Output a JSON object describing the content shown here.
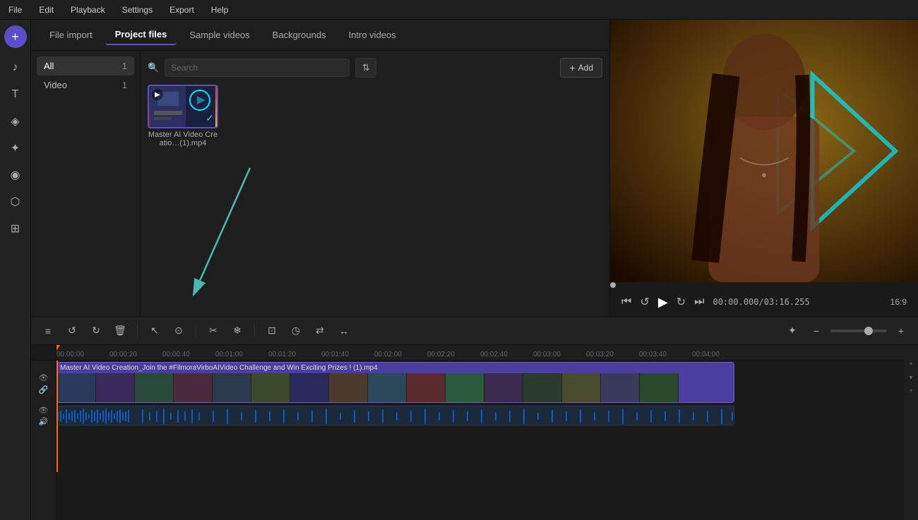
{
  "menubar": {
    "items": [
      "File",
      "Edit",
      "Playback",
      "Settings",
      "Export",
      "Help"
    ]
  },
  "sidebar": {
    "add_icon": "+",
    "items": [
      {
        "name": "music-icon",
        "icon": "♪",
        "active": false
      },
      {
        "name": "text-icon",
        "icon": "T",
        "active": false
      },
      {
        "name": "effects-icon",
        "icon": "◈",
        "active": false
      },
      {
        "name": "sticker-icon",
        "icon": "✦",
        "active": false
      },
      {
        "name": "filters-icon",
        "icon": "◉",
        "active": false
      },
      {
        "name": "mask-icon",
        "icon": "⬡",
        "active": false
      },
      {
        "name": "grid-icon",
        "icon": "⊞",
        "active": false
      }
    ]
  },
  "tabs": {
    "items": [
      {
        "label": "File import",
        "active": false
      },
      {
        "label": "Project files",
        "active": true
      },
      {
        "label": "Sample videos",
        "active": false
      },
      {
        "label": "Backgrounds",
        "active": false
      },
      {
        "label": "Intro videos",
        "active": false
      }
    ]
  },
  "categories": {
    "items": [
      {
        "label": "All",
        "count": 1,
        "active": true
      },
      {
        "label": "Video",
        "count": 1,
        "active": false
      }
    ]
  },
  "search": {
    "placeholder": "Search",
    "value": ""
  },
  "add_button": {
    "label": "Add"
  },
  "files": [
    {
      "name": "Master AI Video Creatio…(1).mp4",
      "duration": "",
      "selected": true
    }
  ],
  "preview": {
    "time_current": "00:00.000",
    "time_total": "03:16.255",
    "aspect_ratio": "16:9"
  },
  "timeline": {
    "clip_label": "Master AI Video Creation_Join the #FilmoraVirboAIVideo Challenge and Win Exciting Prizes ! (1).mp4",
    "rulers": [
      "00:00:00",
      "00:00:20",
      "00:00:40",
      "00:01:00",
      "00:01:20",
      "00:01:40",
      "00:02:00",
      "00:02:20",
      "00:02:40",
      "00:03:00",
      "00:03:20",
      "00:03:40",
      "00:04:00"
    ]
  }
}
